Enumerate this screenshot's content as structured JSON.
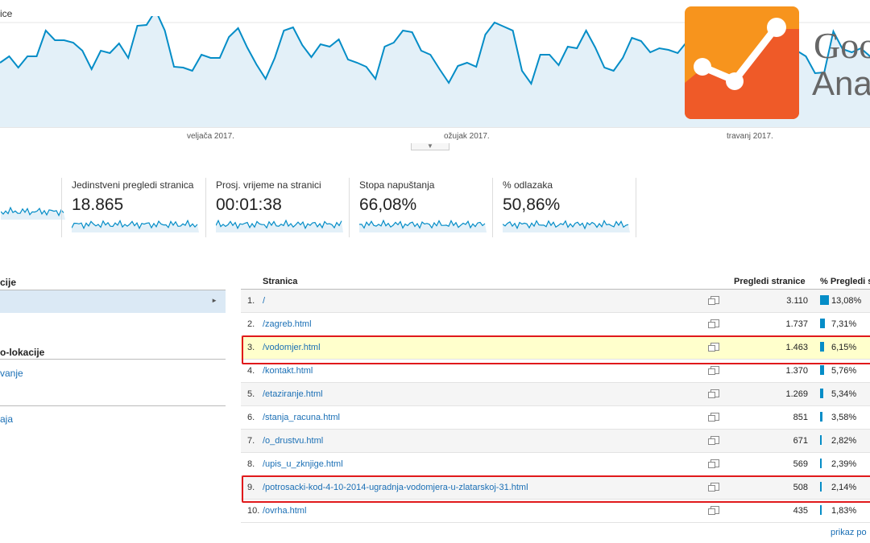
{
  "chart": {
    "title": "ice",
    "color": "#058dc7",
    "months": [
      "veljača 2017.",
      "ožujak 2017.",
      "travanj 2017."
    ],
    "series": [
      80,
      88,
      74,
      88,
      88,
      120,
      108,
      108,
      105,
      95,
      72,
      95,
      92,
      104,
      86,
      126,
      127,
      145,
      120,
      75,
      74,
      70,
      90,
      86,
      86,
      112,
      123,
      99,
      78,
      60,
      86,
      120,
      124,
      102,
      87,
      103,
      100,
      109,
      84,
      80,
      75,
      60,
      100,
      105,
      120,
      118,
      95,
      90,
      72,
      55,
      76,
      80,
      75,
      115,
      130,
      125,
      120,
      70,
      54,
      90,
      90,
      77,
      100,
      98,
      120,
      99,
      74,
      70,
      86,
      111,
      107,
      93,
      98,
      96,
      92,
      106,
      112,
      131,
      107,
      98,
      73,
      57,
      75,
      93,
      78,
      87,
      61,
      95,
      88,
      67,
      68,
      119,
      97,
      93,
      98,
      88
    ]
  },
  "logo": {
    "line1": "Goo",
    "line2": "Anal"
  },
  "metrics": [
    {
      "label": "",
      "value": ""
    },
    {
      "label": "Jedinstveni pregledi stranica",
      "value": "18.865"
    },
    {
      "label": "Prosj. vrijeme na stranici",
      "value": "00:01:38"
    },
    {
      "label": "Stopa napuštanja",
      "value": "66,08%"
    },
    {
      "label": "% odlazaka",
      "value": "50,86%"
    }
  ],
  "left_panel": {
    "heading1": "cije",
    "heading2": "o-lokacije",
    "link1": "vanje",
    "link2": "aja"
  },
  "table": {
    "col_page": "Stranica",
    "col_views": "Pregledi stranice",
    "col_pct": "% Pregledi s",
    "rows": [
      {
        "num": "1.",
        "page": "/",
        "views": "3.110",
        "pct": "13,08%",
        "share": 13.08
      },
      {
        "num": "2.",
        "page": "/zagreb.html",
        "views": "1.737",
        "pct": "7,31%",
        "share": 7.31
      },
      {
        "num": "3.",
        "page": "/vodomjer.html",
        "views": "1.463",
        "pct": "6,15%",
        "share": 6.15
      },
      {
        "num": "4.",
        "page": "/kontakt.html",
        "views": "1.370",
        "pct": "5,76%",
        "share": 5.76
      },
      {
        "num": "5.",
        "page": "/etaziranje.html",
        "views": "1.269",
        "pct": "5,34%",
        "share": 5.34
      },
      {
        "num": "6.",
        "page": "/stanja_racuna.html",
        "views": "851",
        "pct": "3,58%",
        "share": 3.58
      },
      {
        "num": "7.",
        "page": "/o_drustvu.html",
        "views": "671",
        "pct": "2,82%",
        "share": 2.82
      },
      {
        "num": "8.",
        "page": "/upis_u_zknjige.html",
        "views": "569",
        "pct": "2,39%",
        "share": 2.39
      },
      {
        "num": "9.",
        "page": "/potrosacki-kod-4-10-2014-ugradnja-vodomjera-u-zlatarskoj-31.html",
        "views": "508",
        "pct": "2,14%",
        "share": 2.14
      },
      {
        "num": "10.",
        "page": "/ovrha.html",
        "views": "435",
        "pct": "1,83%",
        "share": 1.83
      }
    ],
    "more_link": "prikaz po"
  }
}
